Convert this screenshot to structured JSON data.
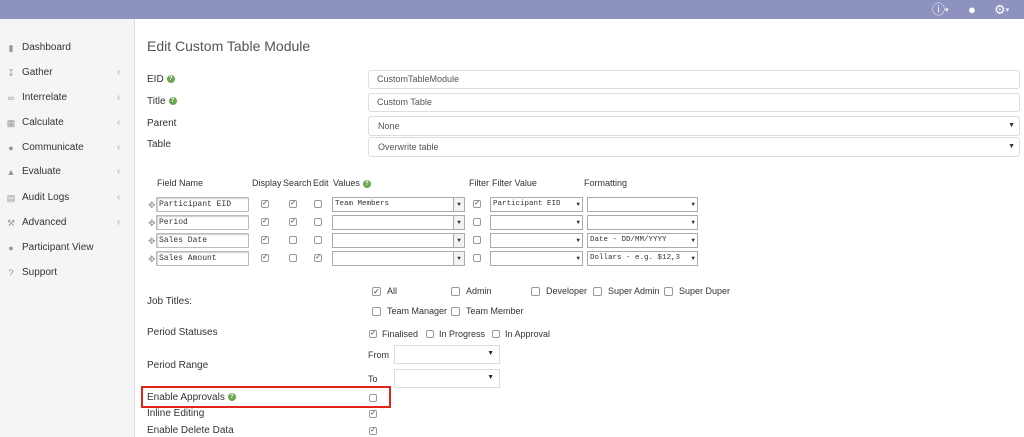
{
  "topbar": {
    "icons": [
      "info-icon",
      "user-icon",
      "gear-icon"
    ]
  },
  "sidebar": {
    "items": [
      {
        "label": "Dashboard",
        "icon": "bar-chart-icon",
        "expandable": false
      },
      {
        "label": "Gather",
        "icon": "download-icon",
        "expandable": true
      },
      {
        "label": "Interrelate",
        "icon": "link-icon",
        "expandable": true
      },
      {
        "label": "Calculate",
        "icon": "table-icon",
        "expandable": true
      },
      {
        "label": "Communicate",
        "icon": "comments-icon",
        "expandable": true
      },
      {
        "label": "Evaluate",
        "icon": "thumbs-up-icon",
        "expandable": true
      },
      {
        "label": "Audit Logs",
        "icon": "file-icon",
        "expandable": true
      },
      {
        "label": "Advanced",
        "icon": "wrench-icon",
        "expandable": true
      },
      {
        "label": "Participant View",
        "icon": "user-icon",
        "expandable": false
      },
      {
        "label": "Support",
        "icon": "question-circle-icon",
        "expandable": false
      }
    ]
  },
  "page": {
    "title": "Edit Custom Table Module"
  },
  "form": {
    "eid_label": "EID",
    "eid_value": "CustomTableModule",
    "title_label": "Title",
    "title_value": "Custom Table",
    "parent_label": "Parent",
    "parent_value": "None",
    "table_label": "Table",
    "table_value": "Overwrite table"
  },
  "fields_table": {
    "headers": {
      "field_name": "Field Name",
      "display": "Display",
      "search": "Search",
      "edit": "Edit",
      "values": "Values",
      "filter": "Filter",
      "filter_value": "Filter Value",
      "formatting": "Formatting"
    },
    "rows": [
      {
        "name": "Participant EID",
        "display": true,
        "search": true,
        "edit": false,
        "values": "Team Members",
        "filter": true,
        "filter_value": "Participant EID",
        "formatting": ""
      },
      {
        "name": "Period",
        "display": true,
        "search": true,
        "edit": false,
        "values": "",
        "filter": false,
        "filter_value": "",
        "formatting": ""
      },
      {
        "name": "Sales Date",
        "display": true,
        "search": false,
        "edit": false,
        "values": "",
        "filter": false,
        "filter_value": "",
        "formatting": "Date - DD/MM/YYYY"
      },
      {
        "name": "Sales Amount",
        "display": true,
        "search": false,
        "edit": true,
        "values": "",
        "filter": false,
        "filter_value": "",
        "formatting": "Dollars - e.g. $12,3"
      }
    ]
  },
  "job_titles": {
    "label": "Job Titles:",
    "options": [
      {
        "label": "All",
        "checked": true
      },
      {
        "label": "Admin",
        "checked": false
      },
      {
        "label": "Developer",
        "checked": false
      },
      {
        "label": "Super Admin",
        "checked": false
      },
      {
        "label": "Super Duper",
        "checked": false
      },
      {
        "label": "Team Manager",
        "checked": false
      },
      {
        "label": "Team Member",
        "checked": false
      }
    ]
  },
  "period_statuses": {
    "label": "Period Statuses",
    "options": [
      {
        "label": "Finalised",
        "checked": true
      },
      {
        "label": "In Progress",
        "checked": false
      },
      {
        "label": "In Approval",
        "checked": false
      }
    ]
  },
  "period_range": {
    "label": "Period Range",
    "from_label": "From",
    "to_label": "To",
    "from_value": "",
    "to_value": ""
  },
  "toggles": [
    {
      "label": "Enable Approvals",
      "checked": false,
      "help": true
    },
    {
      "label": "Inline Editing",
      "checked": true,
      "help": false
    },
    {
      "label": "Enable Delete Data",
      "checked": true,
      "help": false
    }
  ],
  "colors": {
    "topbar": "#8d92bf",
    "highlight_box": "#e2231a",
    "help_icon": "#6aa84f"
  }
}
